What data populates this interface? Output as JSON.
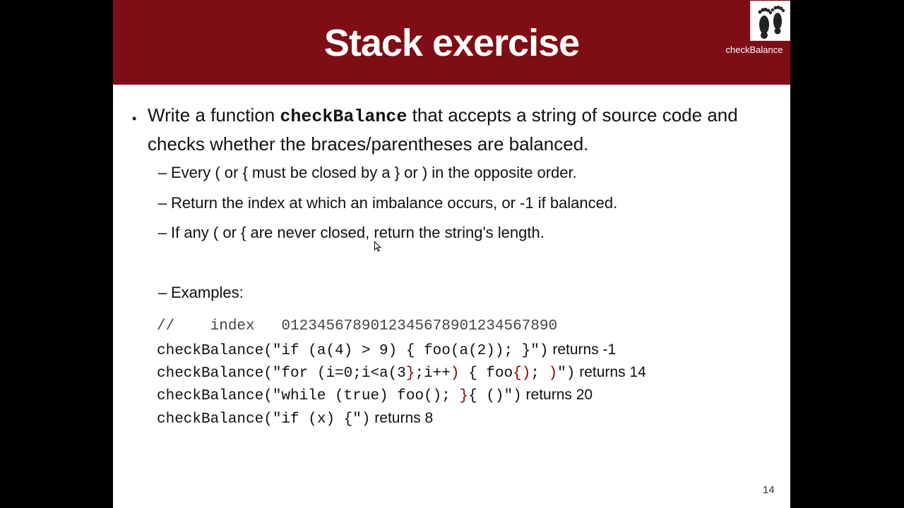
{
  "slide": {
    "title": "Stack exercise",
    "logo_icon": "footprints-icon",
    "logo_caption": "checkBalance",
    "bullet": {
      "part1": "Write a function ",
      "function_name": "checkBalance",
      "part2": " that accepts a string of source code and checks whether the braces/parentheses are balanced."
    },
    "sub_items": [
      "Every ( or { must be closed by a } or ) in the opposite order.",
      "Return the index at which an imbalance occurs, or -1 if balanced.",
      "If any ( or { are never closed, return the string's length.",
      "Examples:"
    ],
    "examples": {
      "index_comment": "//    index   0123456789012345678901234567890",
      "ex1_code": "checkBalance(\"if (a(4) > 9) { foo(a(2)); }\")",
      "ex1_result": " returns -1",
      "ex2_code_a": "checkBalance(\"for (i=0;i<a(3",
      "ex2_hl1": "}",
      "ex2_code_b": ";i++",
      "ex2_hl2": ")",
      "ex2_code_c": " { foo",
      "ex2_hl3": "{)",
      "ex2_code_d": "; ",
      "ex2_hl4": ")",
      "ex2_code_e": "\")",
      "ex2_result": " returns 14",
      "ex3_code_a": "checkBalance(\"while (true) foo(); ",
      "ex3_hl": "}",
      "ex3_code_b": "{ ()\")",
      "ex3_result": " returns 20",
      "ex4_code": "checkBalance(\"if (x) {\")",
      "ex4_result": " returns 8"
    },
    "page_number": "14"
  }
}
